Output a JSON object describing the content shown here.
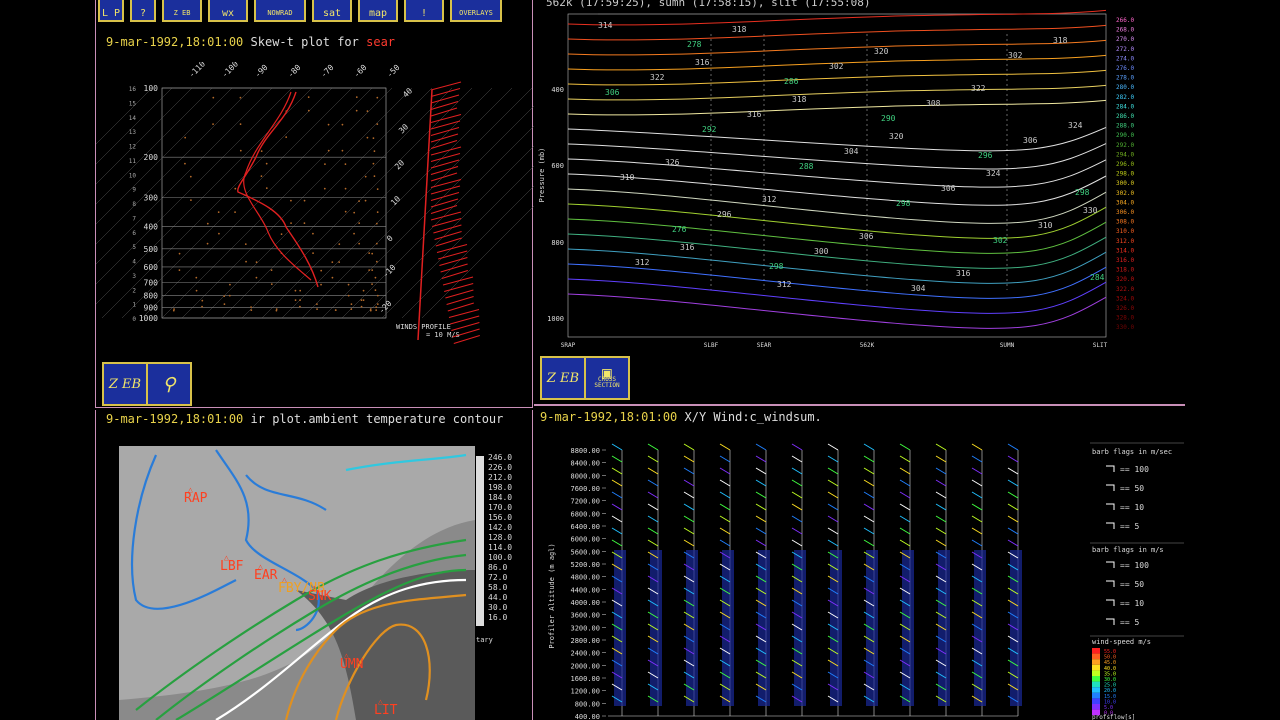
{
  "toolbar_top": {
    "buttons": [
      {
        "label": "L P"
      },
      {
        "label": "?"
      },
      {
        "label": "Z EB"
      },
      {
        "label": "wx"
      },
      {
        "label": "NOWRAD"
      },
      {
        "label": "sat"
      },
      {
        "label": "map"
      },
      {
        "label": "!"
      },
      {
        "label": "OVERLAYS"
      }
    ]
  },
  "skewt": {
    "date": "9-mar-1992,18:01:00",
    "title_prefix": "Skew-t plot for",
    "station": "sear",
    "pressure_labels": [
      "100",
      "200",
      "300",
      "400",
      "500",
      "600",
      "700",
      "800",
      "900",
      "1000"
    ],
    "height_labels": [
      "16",
      "15",
      "14",
      "13",
      "12",
      "11",
      "10",
      "9",
      "8",
      "7",
      "6",
      "5",
      "4",
      "3",
      "2",
      "1",
      "0"
    ],
    "temp_labels": [
      "-110",
      "-100",
      "-90",
      "-80",
      "-70",
      "-60",
      "-50"
    ],
    "right_labels": [
      "40",
      "30",
      "20",
      "10",
      "0",
      "-10",
      "-20"
    ],
    "wind_label": "WINDS PROFILE",
    "wind_scale": "= 10 M/S",
    "buttons": [
      "Z EB",
      "balloon"
    ]
  },
  "cross": {
    "header": "562k (17:59:25), sumn (17:58:15), slit (17:55:08)",
    "ylabel": "Pressure (mb)",
    "y_ticks": [
      "400",
      "600",
      "800",
      "1000"
    ],
    "x_ticks": [
      "SRAP",
      "SLBF",
      "SEAR",
      "562K",
      "SUMN",
      "SLIT"
    ],
    "contour_labels": [
      "314",
      "316",
      "318",
      "320",
      "324",
      "330",
      "316",
      "312",
      "320",
      "322",
      "324",
      "326",
      "312",
      "306",
      "316",
      "318",
      "322",
      "316",
      "304",
      "306",
      "310",
      "312",
      "318",
      "302",
      "308",
      "306",
      "310",
      "296",
      "300",
      "304",
      "302",
      "306",
      "292",
      "288",
      "298",
      "302",
      "284",
      "278",
      "286",
      "290",
      "296",
      "298",
      "276",
      "298"
    ],
    "scale_values": [
      "266.0",
      "268.0",
      "270.0",
      "272.0",
      "274.0",
      "276.0",
      "278.0",
      "280.0",
      "282.0",
      "284.0",
      "286.0",
      "288.0",
      "290.0",
      "292.0",
      "294.0",
      "296.0",
      "298.0",
      "300.0",
      "302.0",
      "304.0",
      "306.0",
      "308.0",
      "310.0",
      "312.0",
      "314.0",
      "316.0",
      "318.0",
      "320.0",
      "322.0",
      "324.0",
      "326.0",
      "328.0",
      "330.0"
    ],
    "scale_colors": [
      "#ff66cc",
      "#f07de0",
      "#d58cf0",
      "#b48cff",
      "#8c8cff",
      "#6c8cff",
      "#5aa0ff",
      "#4ab8ff",
      "#3fd0ff",
      "#3fe0e0",
      "#40e0b0",
      "#40d080",
      "#40c050",
      "#50b030",
      "#70b020",
      "#98c018",
      "#c0d018",
      "#e0d020",
      "#f0c020",
      "#f8a820",
      "#f89020",
      "#f87820",
      "#f86020",
      "#f84820",
      "#f03020",
      "#e02020",
      "#d01818",
      "#c01010",
      "#b01010",
      "#a00808",
      "#900808",
      "#800404",
      "#700404"
    ],
    "buttons": [
      "Z EB",
      "CROSS SECTION"
    ]
  },
  "ir": {
    "date": "9-mar-1992,18:01:00",
    "title": "ir plot.ambient temperature contour",
    "scale_values": [
      "246.0",
      "226.0",
      "212.0",
      "198.0",
      "184.0",
      "170.0",
      "156.0",
      "142.0",
      "128.0",
      "114.0",
      "100.0",
      "86.0",
      "72.0",
      "58.0",
      "44.0",
      "30.0",
      "16.0"
    ],
    "scale_title": "tary",
    "stations": [
      "RAP",
      "LBF",
      "EAR",
      "FBY/NB",
      "SNK",
      "UMN",
      "LIT"
    ]
  },
  "wind": {
    "date": "9-mar-1992,18:01:00",
    "title": "X/Y Wind:c_windsum.",
    "ylabel": "Profiler Altitude (m agl)",
    "y_ticks": [
      "8800.00",
      "8400.00",
      "8000.00",
      "7600.00",
      "7200.00",
      "6800.00",
      "6400.00",
      "6000.00",
      "5600.00",
      "5200.00",
      "4800.00",
      "4400.00",
      "4000.00",
      "3600.00",
      "3200.00",
      "2800.00",
      "2400.00",
      "2000.00",
      "1600.00",
      "1200.00",
      "800.00",
      "400.00"
    ],
    "legend1_title": "barb flags in m/sec",
    "legend1_items": [
      "== 100",
      "== 50",
      "== 10",
      "== 5"
    ],
    "legend2_title": "barb flags in m/s",
    "legend2_items": [
      "== 100",
      "== 50",
      "== 10",
      "== 5"
    ],
    "speed_title": "wind-speed m/s",
    "speed_values": [
      "55.0",
      "50.0",
      "45.0",
      "40.0",
      "35.0",
      "30.0",
      "25.0",
      "20.0",
      "15.0",
      "10.0",
      "5.0",
      "0.0"
    ],
    "speed_colors": [
      "#ff2020",
      "#ff6020",
      "#ffa020",
      "#ffe020",
      "#c0ff20",
      "#40ff40",
      "#20e0c0",
      "#20c0ff",
      "#2080ff",
      "#4040ff",
      "#8030ff",
      "#c030ff"
    ],
    "footer": "profsflow[s]"
  }
}
